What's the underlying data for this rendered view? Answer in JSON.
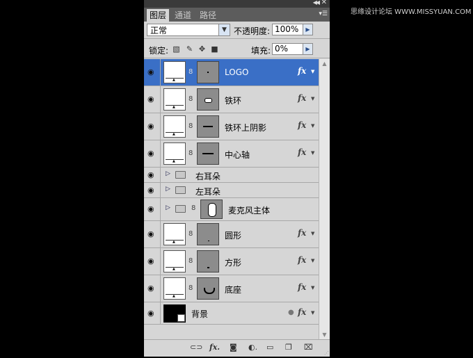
{
  "watermark": "思缘设计论坛 WWW.MISSYUAN.COM",
  "tabs": [
    "图层",
    "通道",
    "路径"
  ],
  "blend_mode": "正常",
  "opacity_label": "不透明度:",
  "opacity_value": "100%",
  "lock_label": "锁定:",
  "fill_label": "填充:",
  "fill_value": "0%",
  "icons": {
    "collapse": "double-chevron-icon",
    "close": "close-icon",
    "panel_menu": "panel-menu-icon",
    "eye": "eye-icon",
    "fx": "fx",
    "link": "link-icon"
  },
  "colors": {
    "selected_row": "#3a6fc6",
    "panel_bg": "#d6d6d6"
  },
  "layers": [
    {
      "name": "LOGO",
      "selected": true,
      "fx": "fx"
    },
    {
      "name": "铁环",
      "fx": "fx"
    },
    {
      "name": "铁环上阴影",
      "fx": "fx"
    },
    {
      "name": "中心轴",
      "fx": "fx"
    },
    {
      "name": "右耳朵"
    },
    {
      "name": "左耳朵"
    },
    {
      "name": "麦克风主体"
    },
    {
      "name": "圆形",
      "fx": "fx"
    },
    {
      "name": "方形",
      "fx": "fx"
    },
    {
      "name": "底座",
      "fx": "fx"
    },
    {
      "name": "背景",
      "fx": "fx"
    }
  ]
}
